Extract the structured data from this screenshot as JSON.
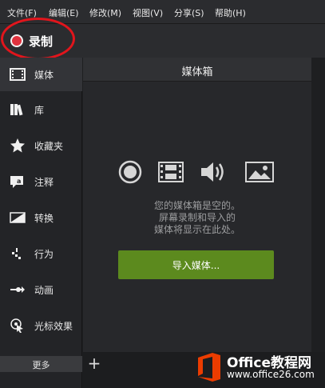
{
  "menu": {
    "items": [
      "文件(F)",
      "编辑(E)",
      "修改(M)",
      "视图(V)",
      "分享(S)",
      "帮助(H)"
    ]
  },
  "record": {
    "label": "录制"
  },
  "sidebar": {
    "items": [
      {
        "label": "媒体",
        "icon": "film-icon",
        "active": true
      },
      {
        "label": "库",
        "icon": "library-icon"
      },
      {
        "label": "收藏夹",
        "icon": "star-icon"
      },
      {
        "label": "注释",
        "icon": "annotation-icon"
      },
      {
        "label": "转换",
        "icon": "transition-icon"
      },
      {
        "label": "行为",
        "icon": "behavior-icon"
      },
      {
        "label": "动画",
        "icon": "animation-icon"
      },
      {
        "label": "光标效果",
        "icon": "cursor-effect-icon"
      }
    ],
    "more_label": "更多"
  },
  "bin": {
    "title": "媒体箱",
    "empty_lines": [
      "您的媒体箱是空的。",
      "屏幕录制和导入的",
      "媒体将显示在此处。"
    ],
    "import_label": "导入媒体...",
    "media_icons": [
      "record-icon",
      "film-icon",
      "audio-icon",
      "image-icon"
    ]
  },
  "bottom": {
    "add_label": "+"
  },
  "watermark": {
    "brand": "Office教程网",
    "url": "www.office26.com"
  },
  "colors": {
    "accent_green": "#5c8a1e",
    "record_red": "#e0323e",
    "annotation_red": "#e1151c",
    "office_orange": "#eb3c00"
  }
}
